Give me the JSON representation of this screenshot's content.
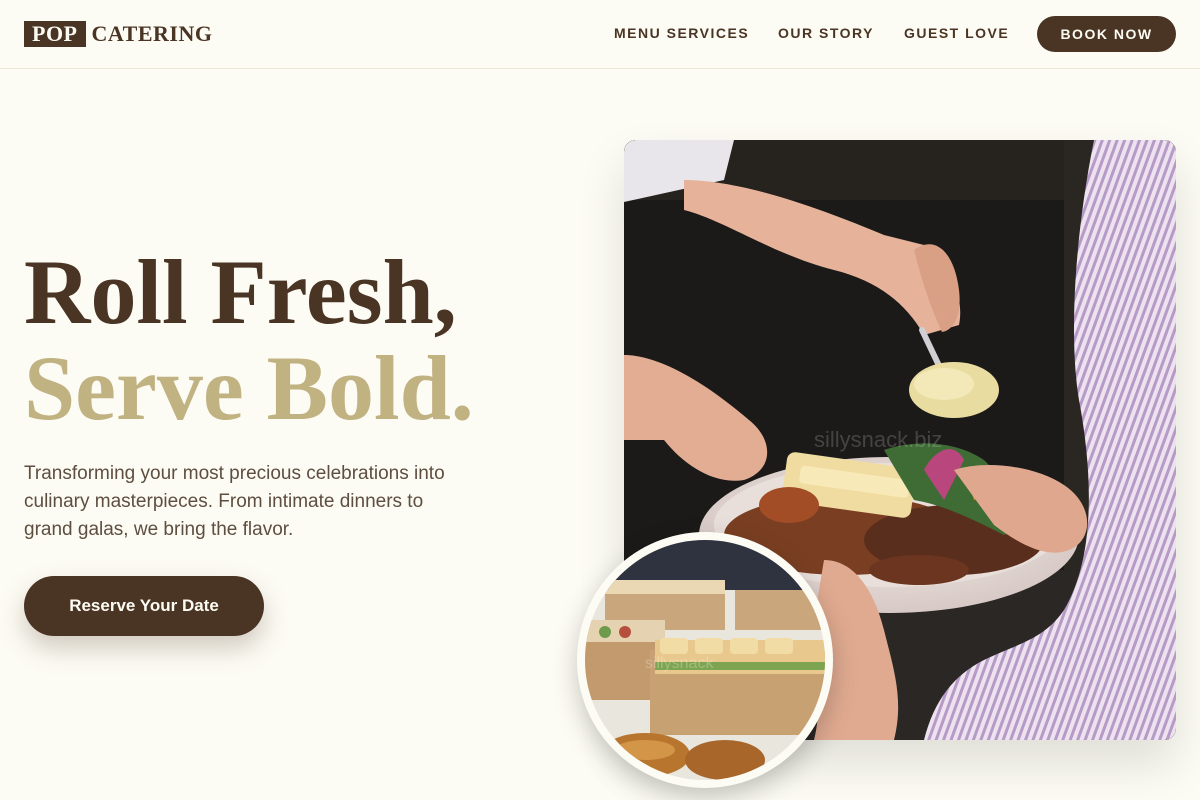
{
  "brand": {
    "logo_box_text": "POP",
    "logo_word": "CATERING"
  },
  "nav": {
    "items": [
      {
        "label": "MENU SERVICES"
      },
      {
        "label": "OUR STORY"
      },
      {
        "label": "GUEST LOVE"
      }
    ],
    "cta_label": "BOOK NOW"
  },
  "hero": {
    "title_line1": "Roll Fresh,",
    "title_line2": "Serve Bold.",
    "lead": "Transforming your most precious celebrations into culinary masterpieces. From intimate dinners to grand galas, we bring the flavor.",
    "cta_label": "Reserve Your Date"
  },
  "colors": {
    "background": "#fdfcf4",
    "brand_brown": "#4a3424",
    "accent_gold": "#c1b282",
    "body_text": "#5e4e40"
  }
}
